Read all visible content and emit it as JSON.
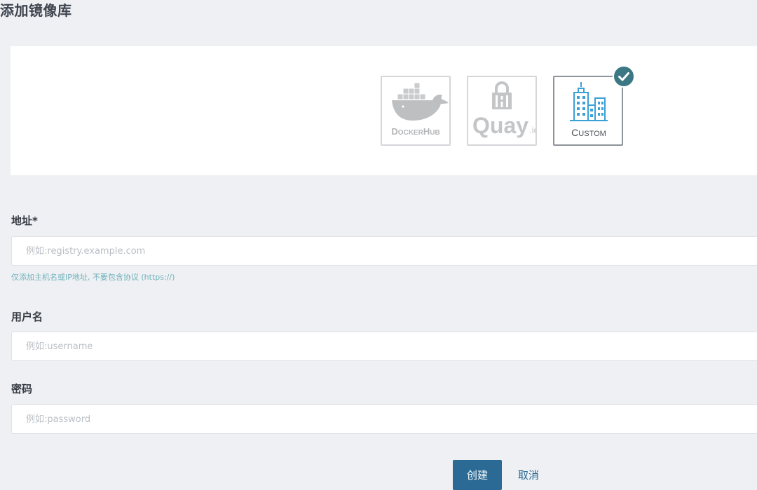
{
  "page": {
    "title": "添加镜像库"
  },
  "registry_options": [
    {
      "key": "dockerhub",
      "label": "DockerHub",
      "icon": "docker-whale-icon",
      "selected": false
    },
    {
      "key": "quay",
      "label": "Quay.io",
      "icon": "quay-lock-icon",
      "selected": false
    },
    {
      "key": "custom",
      "label": "Custom",
      "icon": "buildings-icon",
      "selected": true
    }
  ],
  "form": {
    "address": {
      "label": "地址*",
      "placeholder": "例如:registry.example.com",
      "value": "",
      "hint": "仅添加主机名或IP地址, 不要包含协议 (https://)"
    },
    "username": {
      "label": "用户名",
      "placeholder": "例如:username",
      "value": ""
    },
    "password": {
      "label": "密码",
      "placeholder": "例如:password",
      "value": ""
    }
  },
  "actions": {
    "create_label": "创建",
    "cancel_label": "取消"
  },
  "colors": {
    "page_background": "#eef0f3",
    "panel_background": "#ffffff",
    "primary_button": "#2b6a94",
    "check_badge": "#3c7784",
    "hint_text": "#6fb2bb",
    "custom_icon": "#3aa0d6",
    "disabled_logo": "#b5b7b9"
  }
}
